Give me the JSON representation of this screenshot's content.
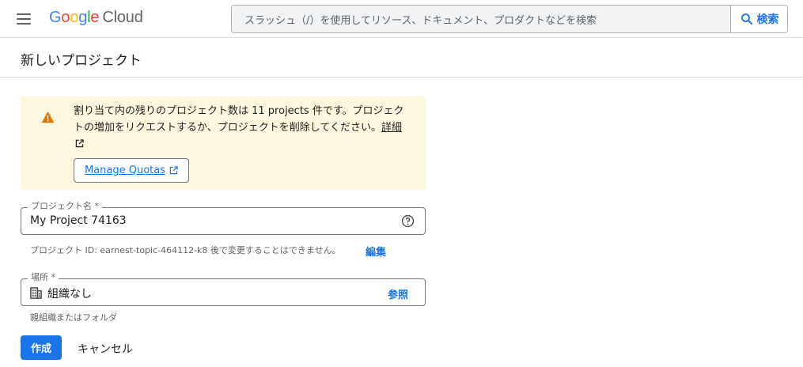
{
  "header": {
    "logo_google": [
      "G",
      "o",
      "o",
      "g",
      "l",
      "e"
    ],
    "logo_cloud": "Cloud",
    "search_placeholder": "スラッシュ（/）を使用してリソース、ドキュメント、プロダクトなどを検索",
    "search_button_label": "検索",
    "icons": {
      "menu": "hamburger-menu-icon",
      "search": "magnifier-icon"
    }
  },
  "page": {
    "title": "新しいプロジェクト"
  },
  "warning": {
    "message": "割り当て内の残りのプロジェクト数は 11 projects 件です。プロジェクトの増加をリクエストするか、プロジェクトを削除してください。",
    "details_link": "詳細",
    "quota_button": "Manage Quotas",
    "icons": {
      "warning": "warning-triangle-icon",
      "external": "external-link-icon"
    },
    "color": "#fef7e0"
  },
  "project_name": {
    "label": "プロジェクト名 *",
    "value": "My Project 74163",
    "hint": "プロジェクト ID: earnest-topic-464112-k8 後で変更することはできません。",
    "edit_link": "編集"
  },
  "location": {
    "label": "場所 *",
    "value": "組織なし",
    "browse_link": "参照",
    "hint": "親組織またはフォルダ"
  },
  "actions": {
    "create": "作成",
    "cancel": "キャンセル"
  },
  "colors": {
    "accent": "#1a73e8",
    "border": "#747775"
  }
}
